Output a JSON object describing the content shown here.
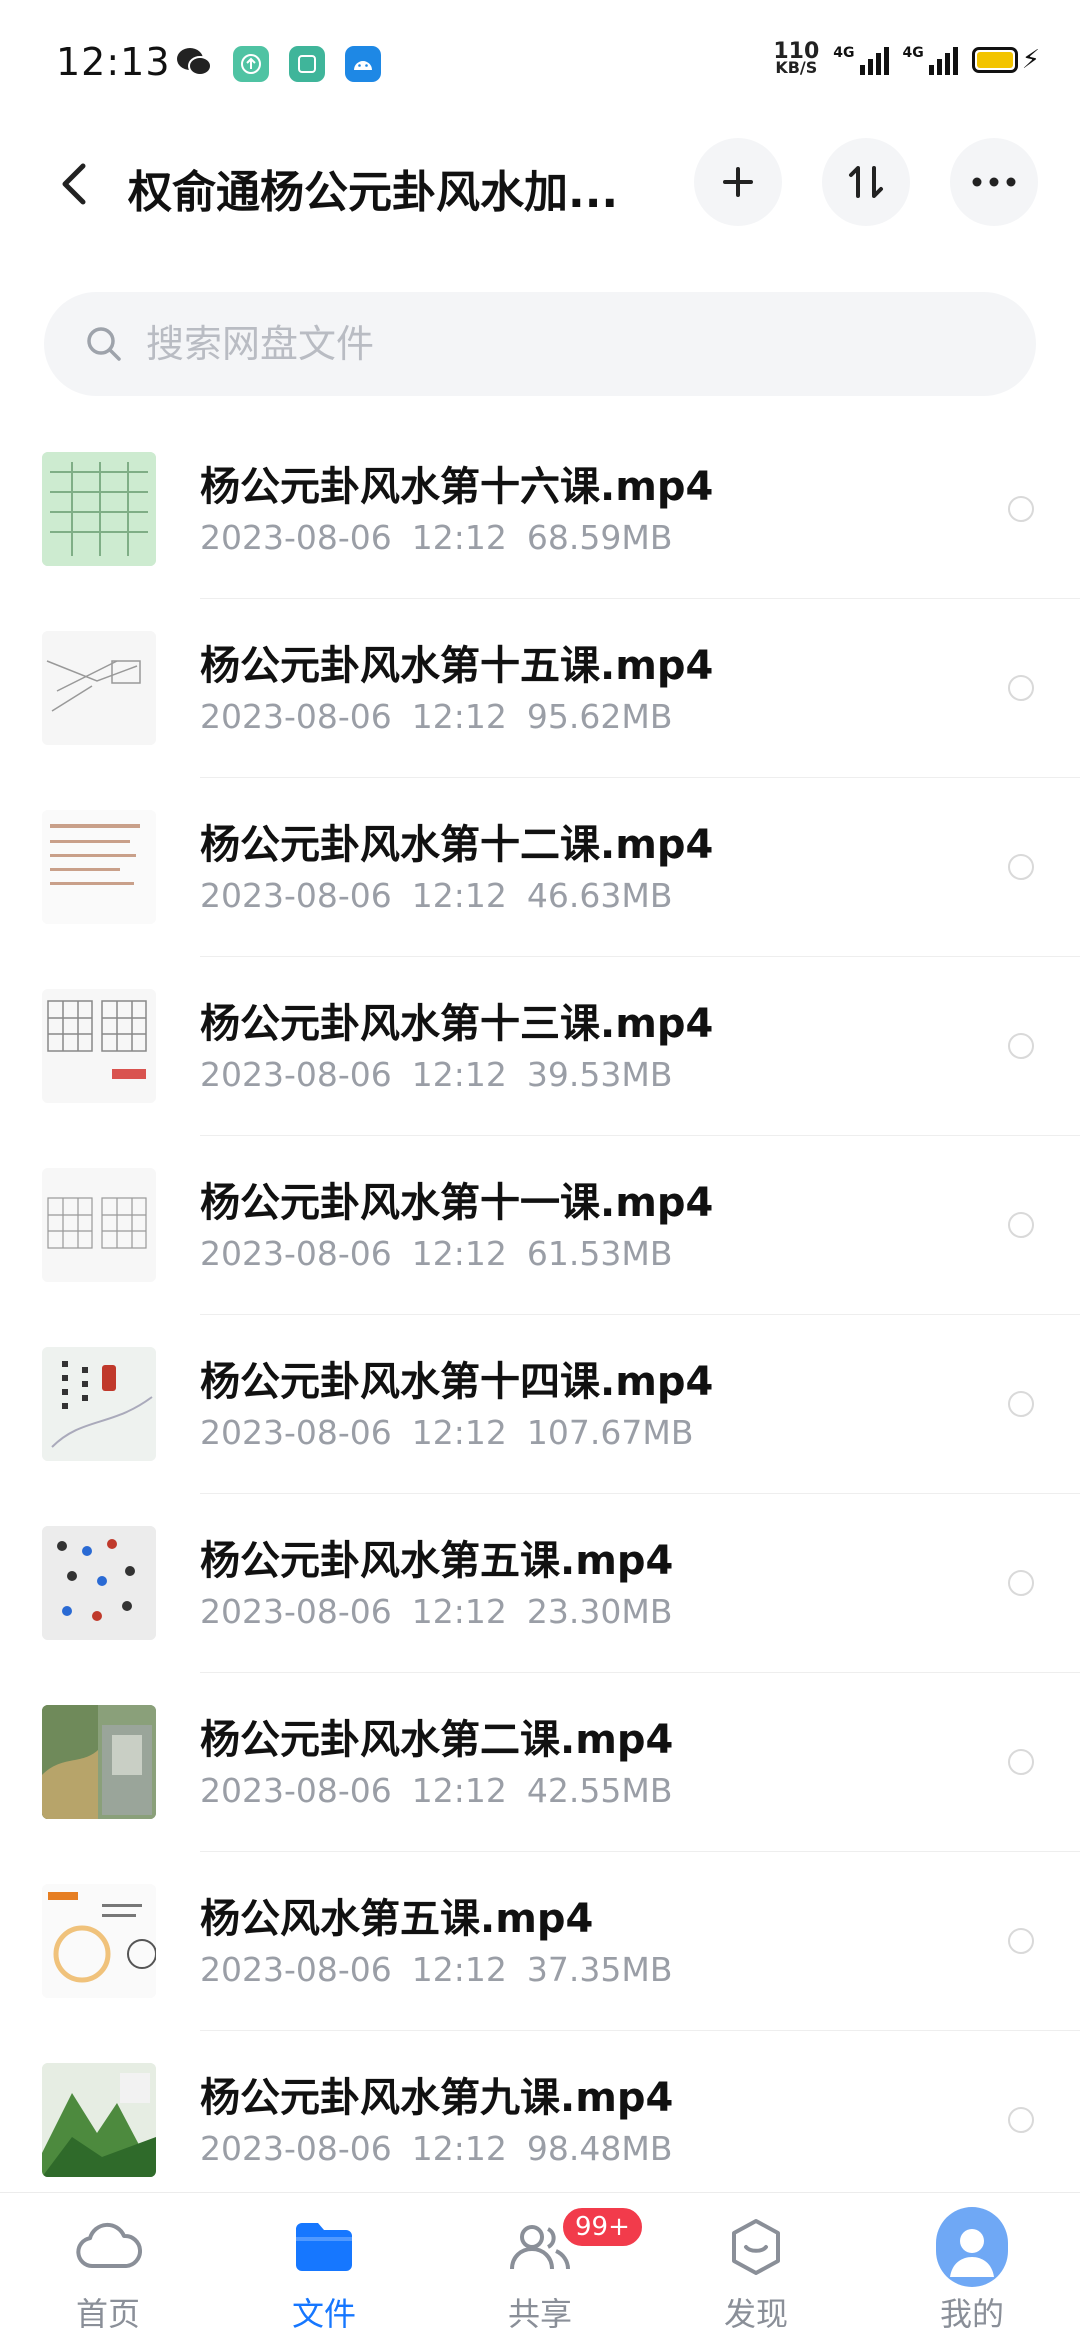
{
  "status_bar": {
    "time": "12:13",
    "net_speed_value": "110",
    "net_speed_unit": "KB/S",
    "signal1_label": "4G",
    "signal2_label": "4G",
    "battery_color": "#f3c400"
  },
  "header": {
    "title": "权俞通杨公元卦风水加...",
    "back_icon": "chevron-left-icon",
    "add_icon": "plus-icon",
    "sort_icon": "sort-icon",
    "more_icon": "more-horizontal-icon"
  },
  "search": {
    "placeholder": "搜索网盘文件"
  },
  "files": [
    {
      "name": "杨公元卦风水第十六课.mp4",
      "date": "2023-08-06",
      "time": "12:12",
      "size": "68.59MB"
    },
    {
      "name": "杨公元卦风水第十五课.mp4",
      "date": "2023-08-06",
      "time": "12:12",
      "size": "95.62MB"
    },
    {
      "name": "杨公元卦风水第十二课.mp4",
      "date": "2023-08-06",
      "time": "12:12",
      "size": "46.63MB"
    },
    {
      "name": "杨公元卦风水第十三课.mp4",
      "date": "2023-08-06",
      "time": "12:12",
      "size": "39.53MB"
    },
    {
      "name": "杨公元卦风水第十一课.mp4",
      "date": "2023-08-06",
      "time": "12:12",
      "size": "61.53MB"
    },
    {
      "name": "杨公元卦风水第十四课.mp4",
      "date": "2023-08-06",
      "time": "12:12",
      "size": "107.67MB"
    },
    {
      "name": "杨公元卦风水第五课.mp4",
      "date": "2023-08-06",
      "time": "12:12",
      "size": "23.30MB"
    },
    {
      "name": "杨公元卦风水第二课.mp4",
      "date": "2023-08-06",
      "time": "12:12",
      "size": "42.55MB"
    },
    {
      "name": "杨公风水第五课.mp4",
      "date": "2023-08-06",
      "time": "12:12",
      "size": "37.35MB"
    },
    {
      "name": "杨公元卦风水第九课.mp4",
      "date": "2023-08-06",
      "time": "12:12",
      "size": "98.48MB"
    }
  ],
  "bottom_nav": {
    "items": [
      {
        "label": "首页",
        "icon": "cloud-icon"
      },
      {
        "label": "文件",
        "icon": "folder-icon"
      },
      {
        "label": "共享",
        "icon": "share-people-icon"
      },
      {
        "label": "发现",
        "icon": "discover-icon"
      },
      {
        "label": "我的",
        "icon": "avatar-icon"
      }
    ],
    "share_badge": "99+",
    "active_color": "#1677ff"
  }
}
